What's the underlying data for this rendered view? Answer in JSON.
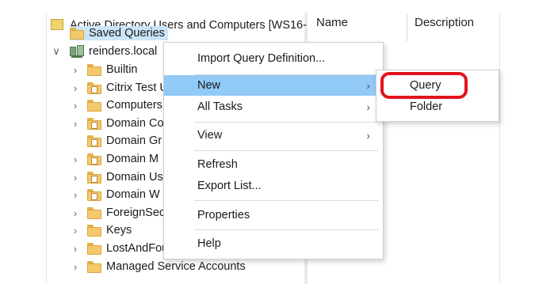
{
  "tree": {
    "root_label": "Active Directory Users and Computers [WS16-",
    "items": [
      {
        "label": "Saved Queries",
        "icon": "folder-icon",
        "expand": "",
        "selected": true
      },
      {
        "label": "reinders.local",
        "icon": "domain-icon",
        "expand": "expanded",
        "selected": false
      },
      {
        "label": "Builtin",
        "icon": "folder-icon",
        "expand": "collapsed",
        "selected": false
      },
      {
        "label": "Citrix Test U",
        "icon": "ou-folder-icon",
        "expand": "collapsed",
        "selected": false
      },
      {
        "label": "Computers",
        "icon": "folder-icon",
        "expand": "collapsed",
        "selected": false
      },
      {
        "label": "Domain Co",
        "icon": "ou-folder-icon",
        "expand": "collapsed",
        "selected": false
      },
      {
        "label": "Domain Gr",
        "icon": "ou-folder-icon",
        "expand": "",
        "selected": false
      },
      {
        "label": "Domain M",
        "icon": "ou-folder-icon",
        "expand": "collapsed",
        "selected": false
      },
      {
        "label": "Domain Us",
        "icon": "ou-folder-icon",
        "expand": "collapsed",
        "selected": false
      },
      {
        "label": "Domain W",
        "icon": "ou-folder-icon",
        "expand": "collapsed",
        "selected": false
      },
      {
        "label": "ForeignSec",
        "icon": "folder-icon",
        "expand": "collapsed",
        "selected": false
      },
      {
        "label": "Keys",
        "icon": "folder-icon",
        "expand": "collapsed",
        "selected": false
      },
      {
        "label": "LostAndFound",
        "icon": "folder-icon",
        "expand": "collapsed",
        "selected": false
      },
      {
        "label": "Managed Service Accounts",
        "icon": "folder-icon",
        "expand": "collapsed",
        "selected": false
      }
    ]
  },
  "list_pane": {
    "columns": [
      "Name",
      "Description"
    ]
  },
  "context_menu": {
    "items": [
      {
        "label": "Import Query Definition...",
        "has_submenu": false,
        "highlighted": false
      },
      {
        "label": "New",
        "has_submenu": true,
        "highlighted": true
      },
      {
        "label": "All Tasks",
        "has_submenu": true,
        "highlighted": false
      },
      {
        "label": "View",
        "has_submenu": true,
        "highlighted": false
      },
      {
        "label": "Refresh",
        "has_submenu": false,
        "highlighted": false
      },
      {
        "label": "Export List...",
        "has_submenu": false,
        "highlighted": false
      },
      {
        "label": "Properties",
        "has_submenu": false,
        "highlighted": false
      },
      {
        "label": "Help",
        "has_submenu": false,
        "highlighted": false
      }
    ]
  },
  "submenu": {
    "items": [
      {
        "label": "Query",
        "annotated": true
      },
      {
        "label": "Folder",
        "annotated": false
      }
    ]
  },
  "colors": {
    "menu_highlight": "#91c9f7",
    "tree_selection": "#cce4f7",
    "annotation_ring": "#e0141e"
  }
}
